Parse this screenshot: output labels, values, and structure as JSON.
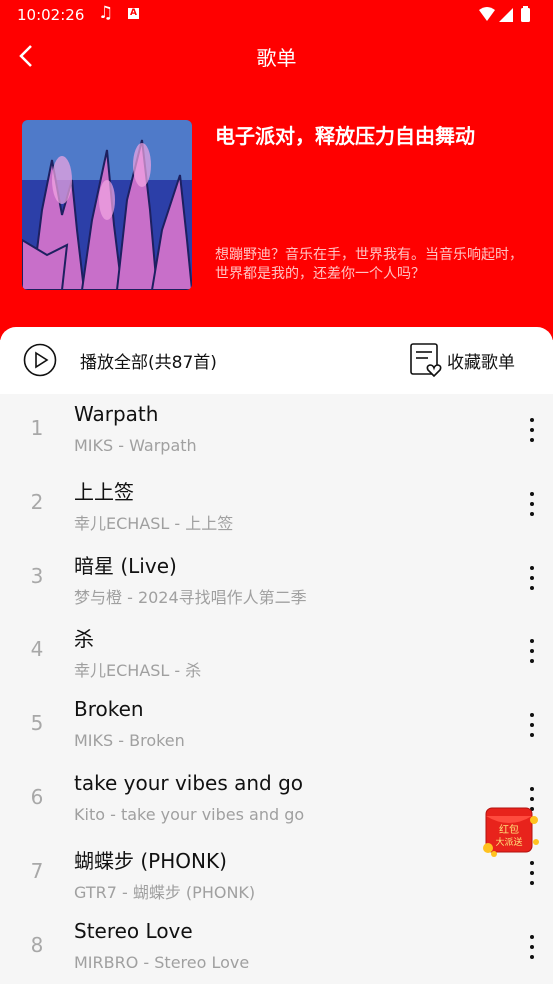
{
  "status_bar": {
    "time": "10:02:26",
    "music_icon": "music-note-icon",
    "notification_icon": "a-badge-icon",
    "right_icons": [
      "wifi-icon",
      "signal-icon",
      "battery-icon"
    ]
  },
  "header": {
    "title": "歌单",
    "back_icon": "back-arrow-icon",
    "background_color": "#ff0000"
  },
  "playlist": {
    "name": "电子派对，释放压力自由舞动",
    "description": "想蹦野迪？音乐在手，世界我有。当音乐响起时，世界都是我的，还差你一个人吗？"
  },
  "actions": {
    "play_all_label": "播放全部(共87首)",
    "collect_label": "收藏歌单"
  },
  "songs": [
    {
      "index": "1",
      "title": "Warpath",
      "subtitle": "MIKS - Warpath"
    },
    {
      "index": "2",
      "title": "上上签",
      "subtitle": "幸儿ECHASL - 上上签"
    },
    {
      "index": "3",
      "title": "暗星 (Live)",
      "subtitle": "梦与橙 - 2024寻找唱作人第二季"
    },
    {
      "index": "4",
      "title": "杀",
      "subtitle": "幸儿ECHASL - 杀"
    },
    {
      "index": "5",
      "title": "Broken",
      "subtitle": "MIKS - Broken"
    },
    {
      "index": "6",
      "title": "take your vibes and go",
      "subtitle": "Kito - take your vibes and go"
    },
    {
      "index": "7",
      "title": "蝴蝶步 (PHONK)",
      "subtitle": "GTR7 - 蝴蝶步 (PHONK)"
    },
    {
      "index": "8",
      "title": "Stereo Love",
      "subtitle": "MIRBRO - Stereo Love"
    }
  ],
  "floating": {
    "red_packet_text_1": "红包",
    "red_packet_text_2": "大派送"
  }
}
